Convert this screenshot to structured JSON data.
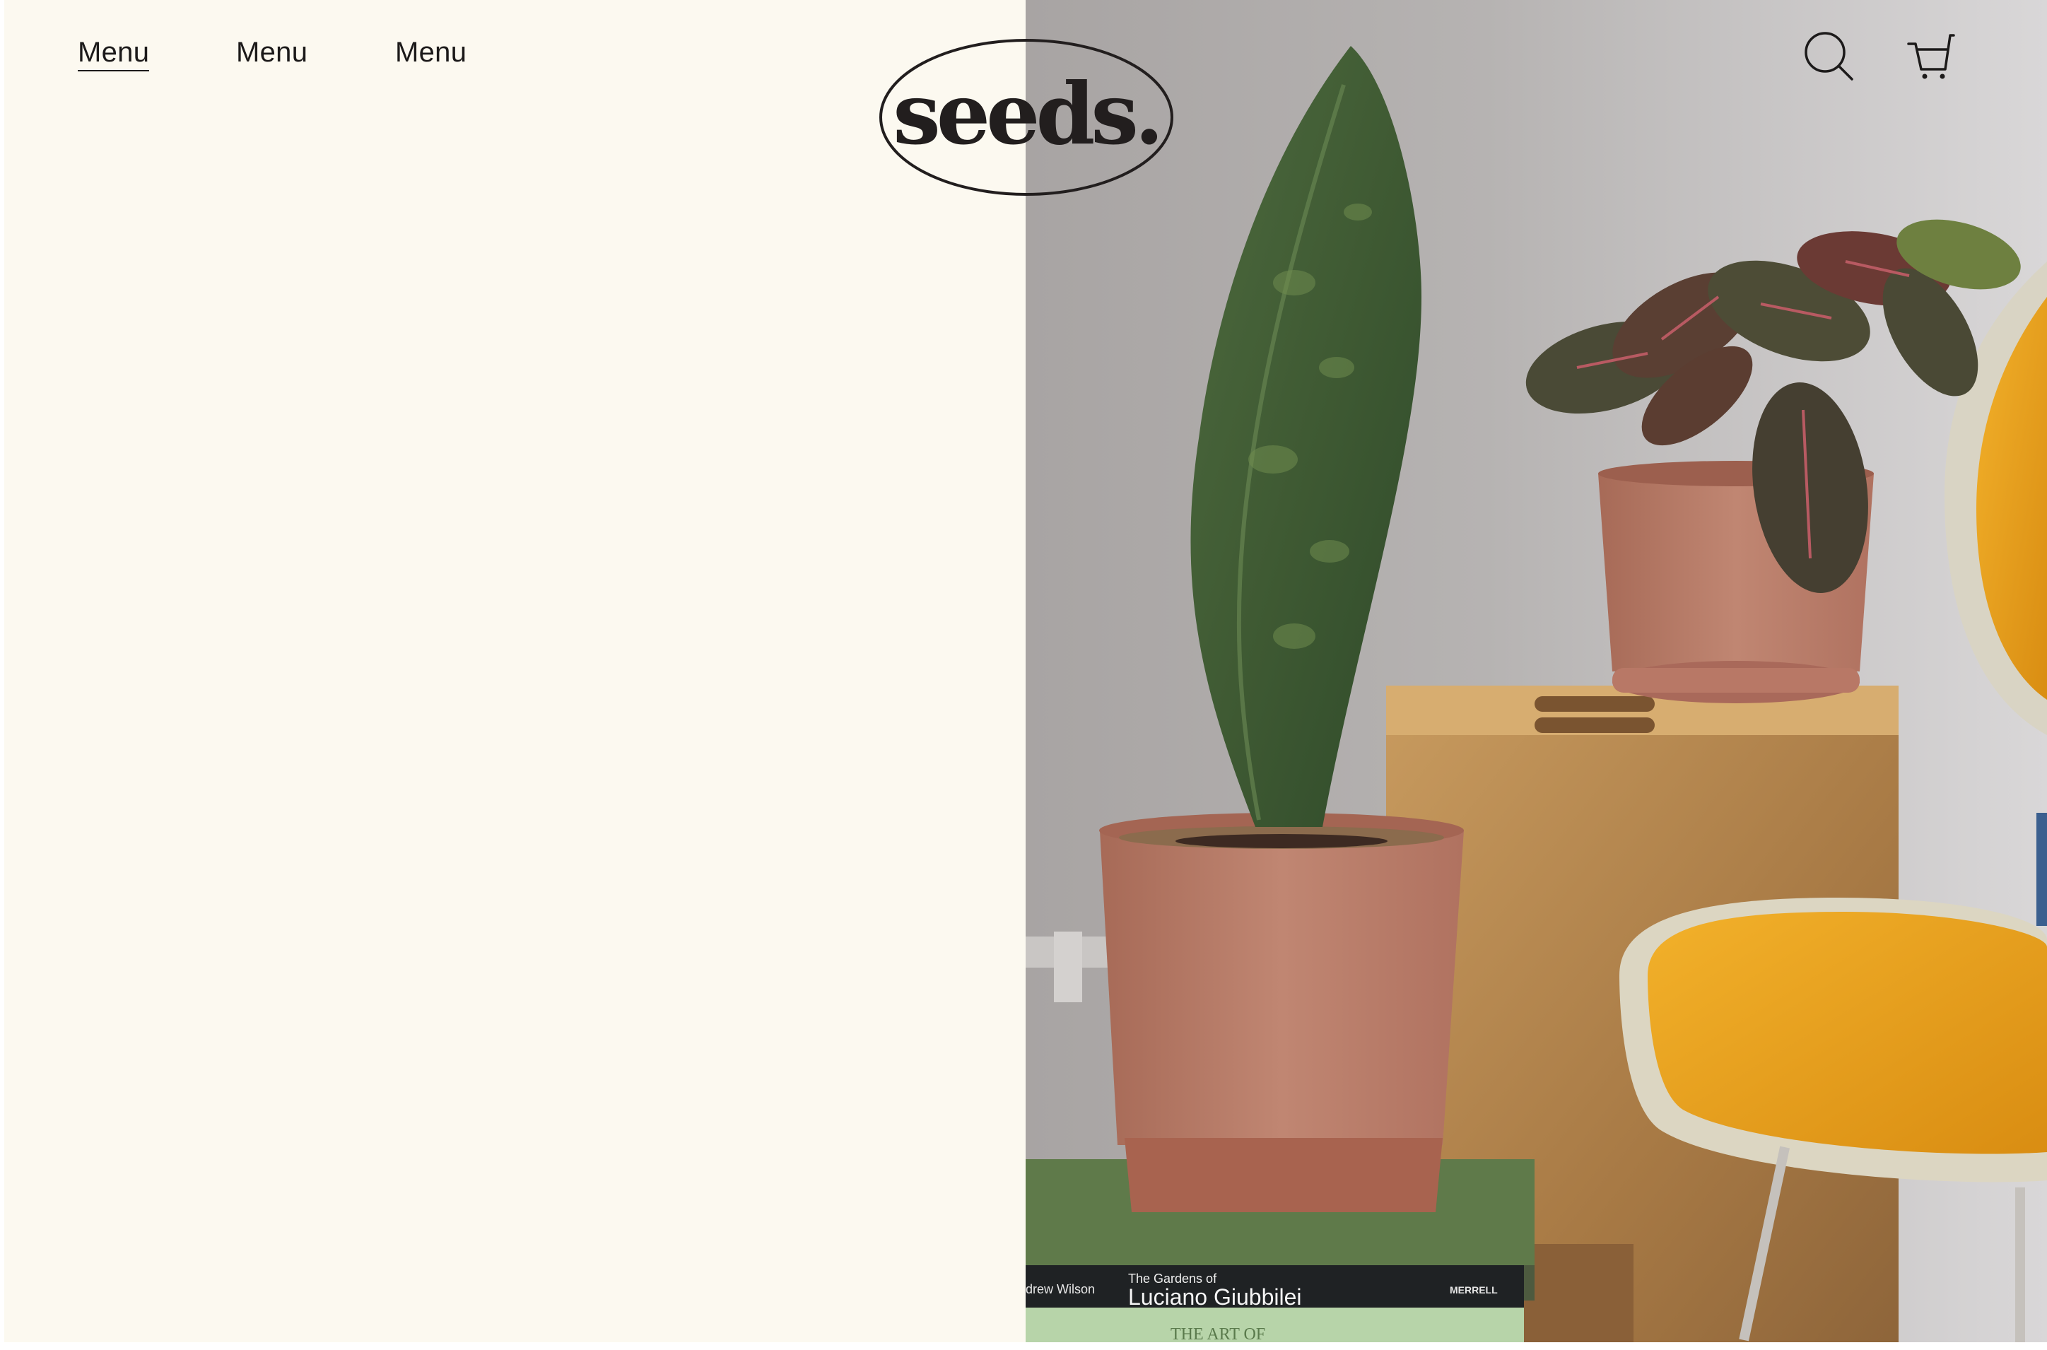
{
  "header": {
    "nav": [
      {
        "label": "Menu",
        "active": true
      },
      {
        "label": "Menu",
        "active": false
      },
      {
        "label": "Menu",
        "active": false
      }
    ],
    "logo": {
      "text": "seeds."
    },
    "icons": [
      "search-icon",
      "cart-icon"
    ]
  },
  "hero_image": {
    "book_top_author": "drew Wilson",
    "book_top_title_small": "The Gardens of",
    "book_top_title": "Luciano Giubbilei",
    "book_top_publisher": "MERRELL",
    "book_bottom_title": "THE ART OF"
  },
  "colors": {
    "background": "#fcf9f0",
    "text": "#1c1a1a",
    "pot": "#b77a68",
    "chair_seat": "#e9a31f"
  }
}
